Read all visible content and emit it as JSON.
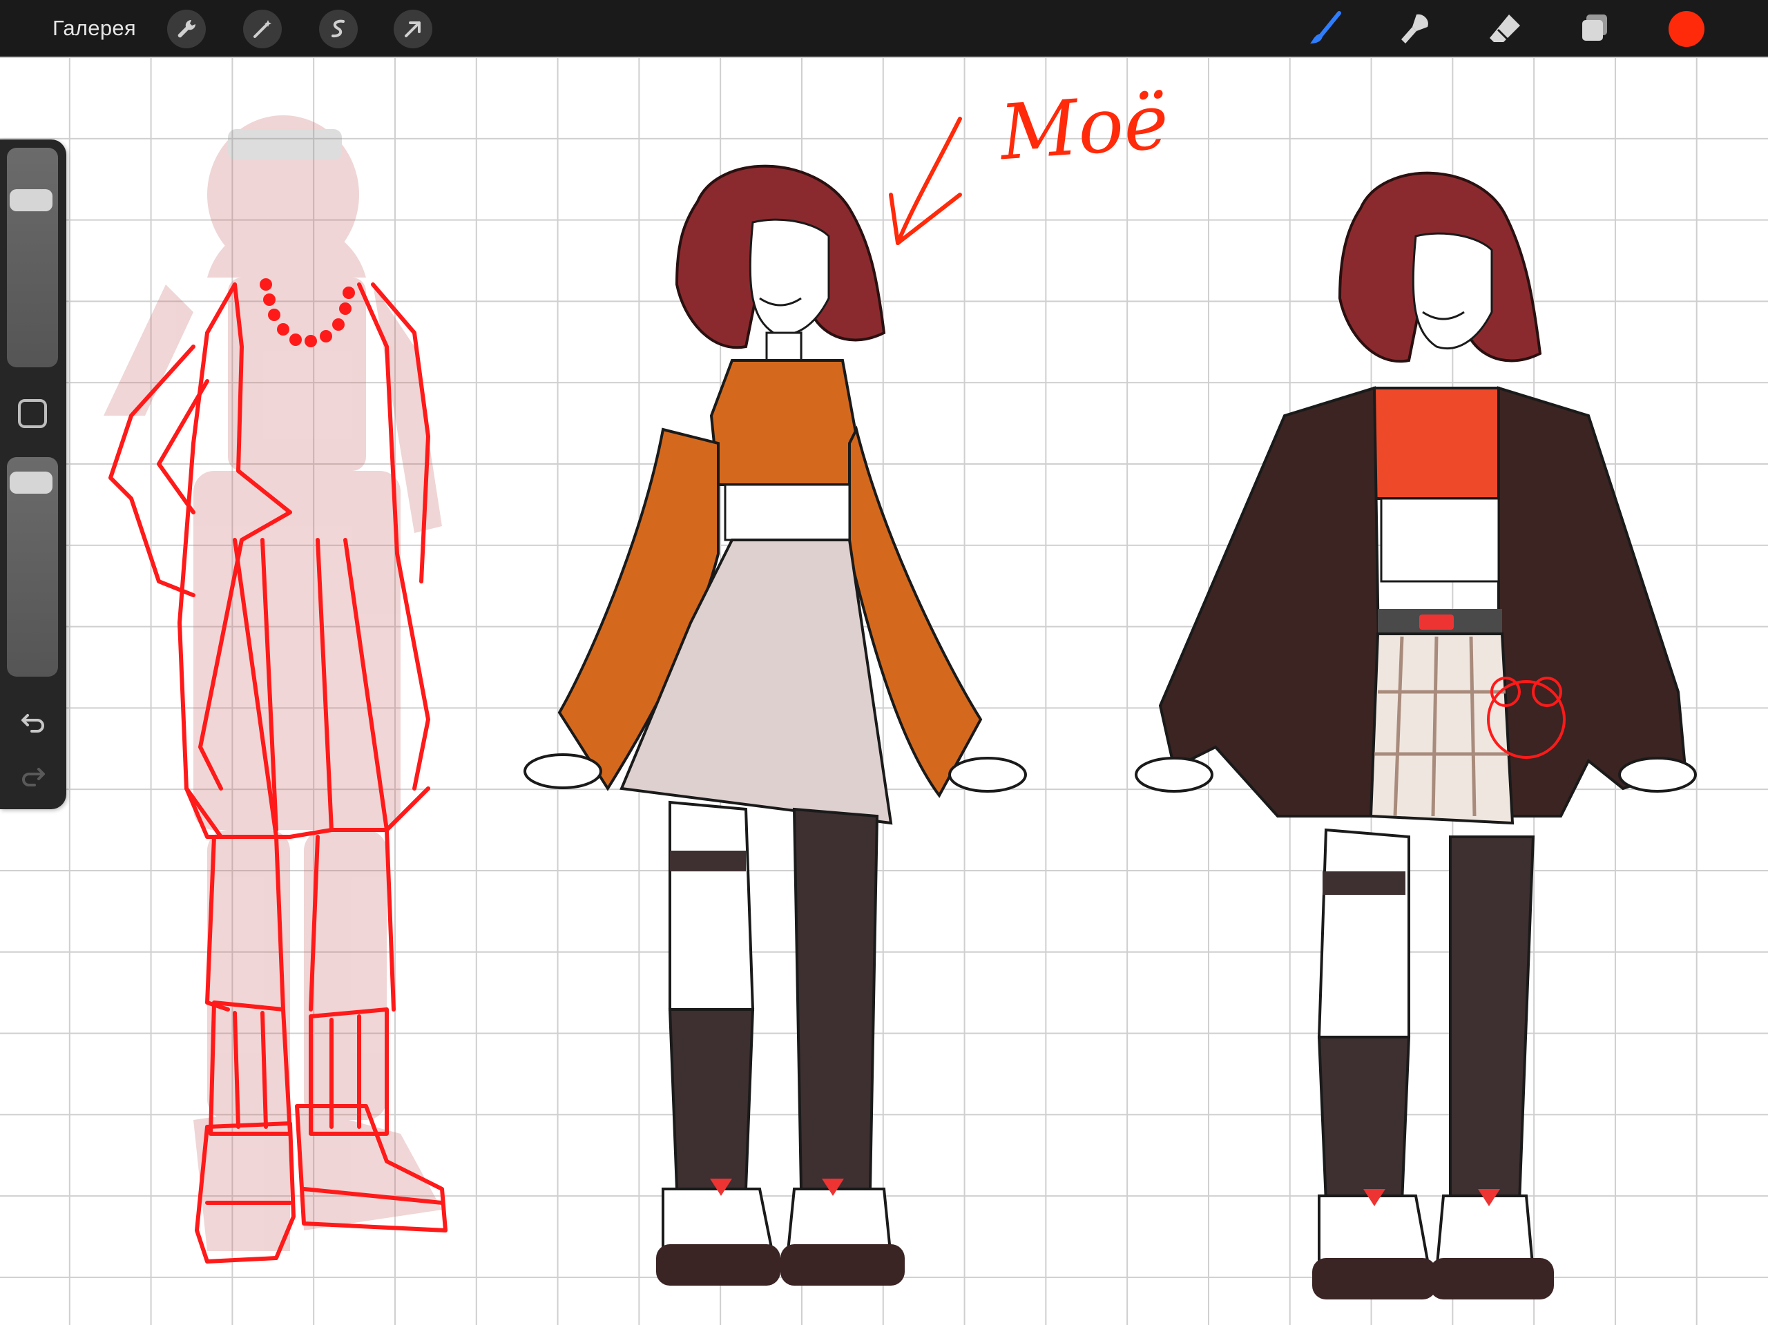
{
  "toolbar": {
    "gallery_label": "Галерея",
    "left_icons": [
      "wrench-icon",
      "magic-wand-icon",
      "selection-icon",
      "transform-arrow-icon"
    ],
    "right_icons": [
      "brush-icon",
      "smudge-icon",
      "eraser-icon",
      "layers-icon"
    ],
    "active_tool": "brush",
    "current_color": "#ff2a0a"
  },
  "sidebar": {
    "brush_size_level": 0.8,
    "opacity_level": 0.94,
    "buttons": [
      "modify-button",
      "undo-icon",
      "redo-icon"
    ]
  },
  "canvas": {
    "annotation_text": "Моё",
    "figures": [
      "reference-sketch",
      "orange-top-outfit",
      "jacket-outfit"
    ],
    "colors": {
      "hair": "#8b2a2e",
      "orange_top": "#d4691e",
      "bright_top": "#ee4a2a",
      "jacket": "#3b2422",
      "stockings": "#3e2f30",
      "skirt": "#ddd0cf",
      "red_line": "#ff1a1a"
    }
  }
}
